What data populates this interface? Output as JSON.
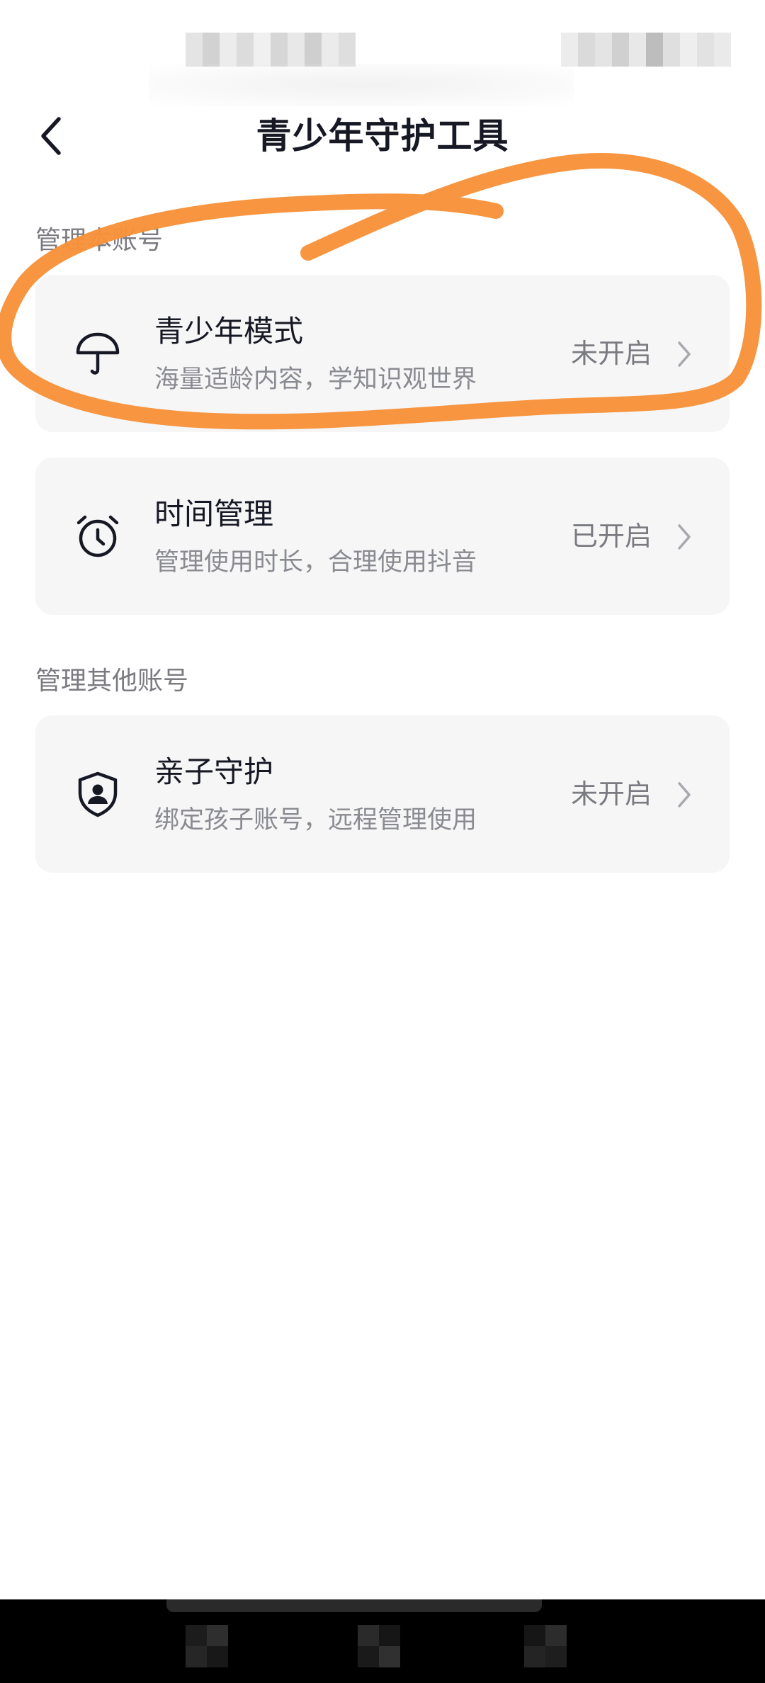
{
  "header": {
    "title": "青少年守护工具",
    "back_icon": "chevron-left-icon"
  },
  "sections": [
    {
      "header": "管理本账号",
      "items": [
        {
          "icon": "umbrella-icon",
          "title": "青少年模式",
          "description": "海量适龄内容，学知识观世界",
          "status": "未开启"
        },
        {
          "icon": "alarm-clock-icon",
          "title": "时间管理",
          "description": "管理使用时长，合理使用抖音",
          "status": "已开启"
        }
      ]
    },
    {
      "header": "管理其他账号",
      "items": [
        {
          "icon": "shield-user-icon",
          "title": "亲子守护",
          "description": "绑定孩子账号，远程管理使用",
          "status": "未开启"
        }
      ]
    }
  ],
  "colors": {
    "annotation": "#f7923a",
    "title_text": "#161823",
    "card_background": "#f6f6f7",
    "secondary_text": "#8a8b91"
  }
}
